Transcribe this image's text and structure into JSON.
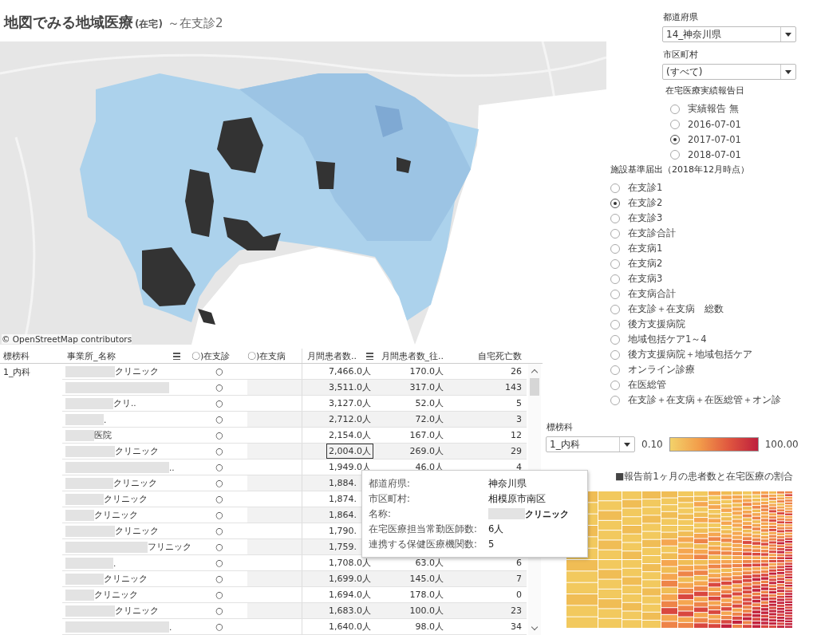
{
  "title": {
    "main": "地図でみる地域医療",
    "note": "(在宅)",
    "sub": "～在支診2"
  },
  "map": {
    "kind": "picture",
    "attribution": "© OpenStreetMap contributors"
  },
  "filters": [
    {
      "label": "都道府県",
      "value": "14_神奈川県"
    },
    {
      "label": "市区町村",
      "value": "(すべて)"
    }
  ],
  "report_date": {
    "label": "在宅医療実績報告日",
    "options": [
      {
        "label": "実績報告 無",
        "selected": false
      },
      {
        "label": "2016-07-01",
        "selected": false
      },
      {
        "label": "2017-07-01",
        "selected": true
      },
      {
        "label": "2018-07-01",
        "selected": false
      }
    ]
  },
  "facility_standard": {
    "label": "施設基準届出（2018年12月時点）",
    "options": [
      {
        "label": "在支診1",
        "selected": false
      },
      {
        "label": "在支診2",
        "selected": true
      },
      {
        "label": "在支診3",
        "selected": false
      },
      {
        "label": "在支診合計",
        "selected": false
      },
      {
        "label": "在支病1",
        "selected": false
      },
      {
        "label": "在支病2",
        "selected": false
      },
      {
        "label": "在支病3",
        "selected": false
      },
      {
        "label": "在支病合計",
        "selected": false
      },
      {
        "label": "在支診＋在支病　総数",
        "selected": false
      },
      {
        "label": "後方支援病院",
        "selected": false
      },
      {
        "label": "地域包括ケア1～4",
        "selected": false
      },
      {
        "label": "後方支援病院＋地域包括ケア",
        "selected": false
      },
      {
        "label": "オンライン診療",
        "selected": false
      },
      {
        "label": "在医総管",
        "selected": false
      },
      {
        "label": "在支診＋在支病＋在医総管＋オン診",
        "selected": false
      }
    ]
  },
  "table": {
    "columns": [
      "標榜科",
      "事業所_名称",
      "〇)在支診",
      "〇)在支病",
      "月間患者数..",
      "月間患者数_往..",
      "自宅死亡数"
    ],
    "group": "1_内科",
    "rows": [
      {
        "name": "クリニック",
        "redacted": true,
        "zaishin": "○",
        "patients": "7,466.0人",
        "visits": "170.0人",
        "deaths": "26",
        "selected": false
      },
      {
        "redacted": true,
        "zaishin": "○",
        "patients": "3,511.0人",
        "visits": "317.0人",
        "deaths": "143",
        "selected": false
      },
      {
        "name": "クリ..",
        "redacted": true,
        "zaishin": "○",
        "patients": "3,127.0人",
        "visits": "52.0人",
        "deaths": "5",
        "selected": false
      },
      {
        "name": ".",
        "redacted": true,
        "zaishin": "○",
        "patients": "2,712.0人",
        "visits": "72.0人",
        "deaths": "3",
        "selected": false
      },
      {
        "name": "医院",
        "redacted": true,
        "zaishin": "○",
        "patients": "2,154.0人",
        "visits": "167.0人",
        "deaths": "12",
        "selected": false
      },
      {
        "name": "クリニック",
        "redacted": true,
        "zaishin": "○",
        "patients": "2,004.0人",
        "visits": "269.0人",
        "deaths": "29",
        "selected": true
      },
      {
        "name": "..",
        "redacted": true,
        "zaishin": "○",
        "patients": "1,949.0人",
        "visits": "46.0人",
        "deaths": "4",
        "selected": false
      },
      {
        "name": "クリニック",
        "redacted": true,
        "zaishin": "○",
        "patients": "1,884.",
        "selected": false
      },
      {
        "name": "クリニック",
        "redacted": true,
        "zaishin": "○",
        "patients": "1,874.",
        "selected": false
      },
      {
        "name": "クリニック",
        "redacted": true,
        "zaishin": "○",
        "patients": "1,864.",
        "selected": false
      },
      {
        "name": "クリニック",
        "redacted": true,
        "zaishin": "○",
        "patients": "1,790.",
        "selected": false
      },
      {
        "name": "フリニック",
        "redacted": true,
        "zaishin": "○",
        "patients": "1,759.",
        "selected": false
      },
      {
        "name": ".",
        "redacted": true,
        "zaishin": "○",
        "patients": "1,708.0人",
        "visits": "63.0人",
        "deaths": "6",
        "selected": false
      },
      {
        "name": "クリニック",
        "redacted": true,
        "zaishin": "○",
        "patients": "1,699.0人",
        "visits": "145.0人",
        "deaths": "7",
        "selected": false
      },
      {
        "name": "クリニック",
        "redacted": true,
        "zaishin": "○",
        "patients": "1,694.0人",
        "visits": "178.0人",
        "deaths": "0",
        "selected": false
      },
      {
        "name": "クリニック",
        "redacted": true,
        "zaishin": "○",
        "patients": "1,683.0人",
        "visits": "100.0人",
        "deaths": "23",
        "selected": false
      },
      {
        "name": ".",
        "redacted": true,
        "zaishin": "○",
        "patients": "1,640.0人",
        "visits": "98.0人",
        "deaths": "34",
        "selected": false
      }
    ]
  },
  "tooltip": [
    {
      "label": "都道府県:",
      "value": "神奈川県"
    },
    {
      "label": "市区町村:",
      "value": "相模原市南区"
    },
    {
      "label": "名称:",
      "value": "クリニック",
      "redacted": true
    },
    {
      "label": "在宅医療担当常勤医師数:",
      "value": "6人"
    },
    {
      "label": "連携する保健医療機関数:",
      "value": "5"
    }
  ],
  "specialty_filter": {
    "label": "標榜科",
    "value": "1_内科"
  },
  "color_legend": {
    "min": "0.10",
    "max": "100.00"
  },
  "treemap": {
    "title": "■報告前1ヶ月の患者数と在宅医療の割合",
    "kind": "picture"
  }
}
